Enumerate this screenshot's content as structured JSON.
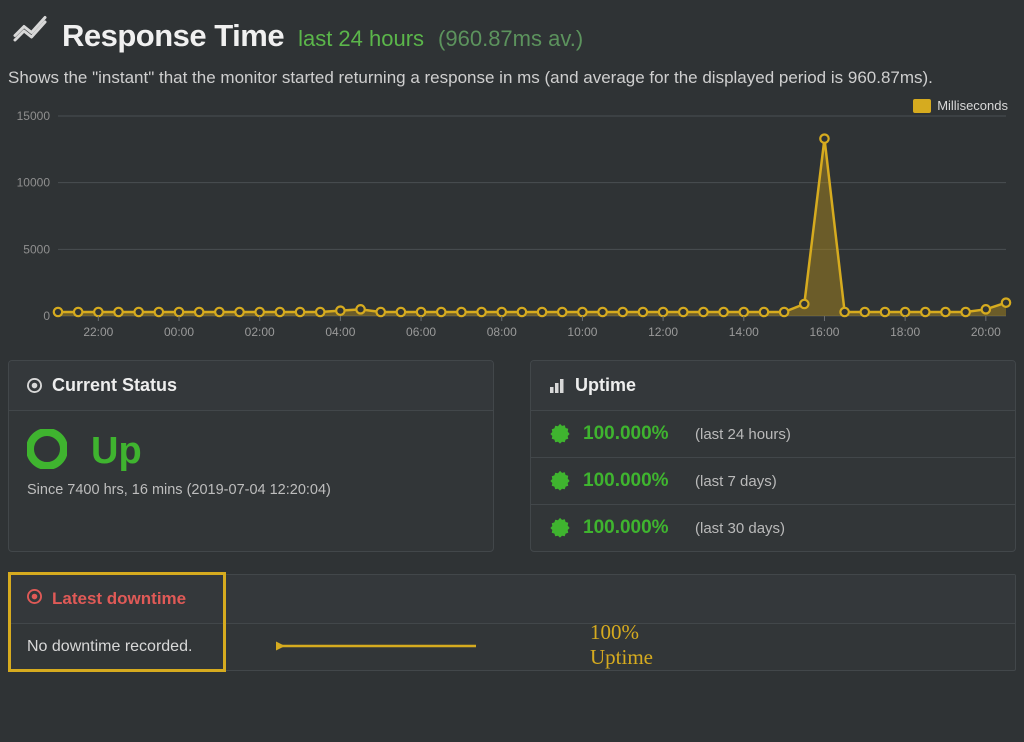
{
  "header": {
    "title": "Response Time",
    "subtitle_span1": "last 24 hours",
    "subtitle_span2": "(960.87ms av.)"
  },
  "description": "Shows the \"instant\" that the monitor started returning a response in ms (and average for the displayed period is 960.87ms).",
  "legend": {
    "label": "Milliseconds"
  },
  "current_status": {
    "header": "Current Status",
    "state": "Up",
    "since": "Since 7400 hrs, 16 mins (2019-07-04 12:20:04)"
  },
  "uptime": {
    "header": "Uptime",
    "rows": [
      {
        "pct": "100.000%",
        "range": "(last 24 hours)"
      },
      {
        "pct": "100.000%",
        "range": "(last 7 days)"
      },
      {
        "pct": "100.000%",
        "range": "(last 30 days)"
      }
    ]
  },
  "downtime": {
    "header": "Latest downtime",
    "body": "No downtime recorded."
  },
  "annotation": {
    "text": "100% Uptime"
  },
  "colors": {
    "accent_green": "#3fb42f",
    "accent_yellow": "#d6ab1f",
    "accent_red": "#e05a57",
    "bg": "#2f3335"
  },
  "chart_data": {
    "type": "line",
    "title": "Response Time last 24 hours",
    "xlabel": "",
    "ylabel": "",
    "ylim": [
      0,
      15000
    ],
    "x_tick_labels": [
      "22:00",
      "00:00",
      "02:00",
      "04:00",
      "06:00",
      "08:00",
      "10:00",
      "12:00",
      "14:00",
      "16:00",
      "18:00",
      "20:00"
    ],
    "series": [
      {
        "name": "Milliseconds",
        "x": [
          "21:00",
          "21:30",
          "22:00",
          "22:30",
          "23:00",
          "23:30",
          "00:00",
          "00:30",
          "01:00",
          "01:30",
          "02:00",
          "02:30",
          "03:00",
          "03:30",
          "04:00",
          "04:30",
          "05:00",
          "05:30",
          "06:00",
          "06:30",
          "07:00",
          "07:30",
          "08:00",
          "08:30",
          "09:00",
          "09:30",
          "10:00",
          "10:30",
          "11:00",
          "11:30",
          "12:00",
          "12:30",
          "13:00",
          "13:30",
          "14:00",
          "14:30",
          "15:00",
          "15:30",
          "16:00",
          "16:30",
          "17:00",
          "17:30",
          "18:00",
          "18:30",
          "19:00",
          "19:30",
          "20:00",
          "20:30"
        ],
        "y": [
          300,
          300,
          300,
          300,
          300,
          300,
          300,
          300,
          300,
          300,
          300,
          300,
          300,
          300,
          400,
          500,
          300,
          300,
          300,
          300,
          300,
          300,
          300,
          300,
          300,
          300,
          300,
          300,
          300,
          300,
          300,
          300,
          300,
          300,
          300,
          300,
          300,
          900,
          13300,
          300,
          300,
          300,
          300,
          300,
          300,
          300,
          500,
          1000
        ]
      }
    ]
  }
}
